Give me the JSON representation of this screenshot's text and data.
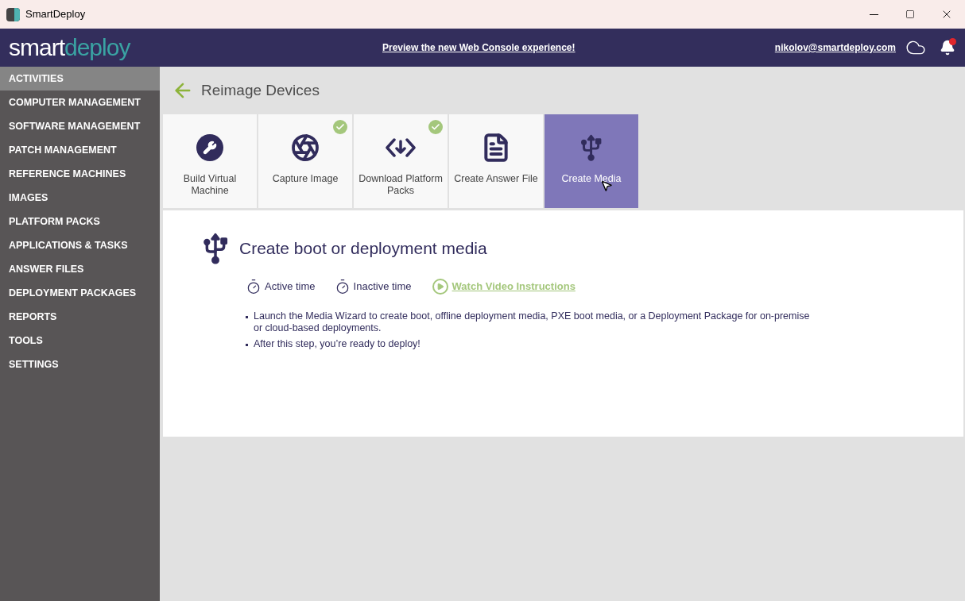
{
  "window": {
    "title": "SmartDeploy"
  },
  "header": {
    "logo": [
      "smart",
      "deploy"
    ],
    "banner_link": "Preview the new Web Console experience!",
    "user_email": "nikolov@smartdeploy.com",
    "notification_unread": true
  },
  "sidebar": {
    "items": [
      {
        "label": "ACTIVITIES",
        "selected": true
      },
      {
        "label": "COMPUTER MANAGEMENT",
        "selected": false
      },
      {
        "label": "SOFTWARE MANAGEMENT",
        "selected": false
      },
      {
        "label": "PATCH MANAGEMENT",
        "selected": false
      },
      {
        "label": "REFERENCE MACHINES",
        "selected": false
      },
      {
        "label": "IMAGES",
        "selected": false
      },
      {
        "label": "PLATFORM PACKS",
        "selected": false
      },
      {
        "label": "APPLICATIONS & TASKS",
        "selected": false
      },
      {
        "label": "ANSWER FILES",
        "selected": false
      },
      {
        "label": "DEPLOYMENT PACKAGES",
        "selected": false
      },
      {
        "label": "REPORTS",
        "selected": false
      },
      {
        "label": "TOOLS",
        "selected": false
      },
      {
        "label": "SETTINGS",
        "selected": false
      }
    ]
  },
  "page": {
    "title": "Reimage Devices"
  },
  "steps": [
    {
      "kind": "wrench",
      "label": "Build Virtual Machine",
      "done": false,
      "selected": false
    },
    {
      "kind": "aperture",
      "label": "Capture Image",
      "done": true,
      "selected": false
    },
    {
      "kind": "download",
      "label": "Download Platform Packs",
      "done": true,
      "selected": false
    },
    {
      "kind": "file",
      "label": "Create Answer File",
      "done": false,
      "selected": false
    },
    {
      "kind": "usb",
      "label": "Create Media",
      "done": false,
      "selected": true
    }
  ],
  "detail": {
    "title": "Create boot or deployment media",
    "active_time": "Active time",
    "inactive_time": "Inactive time",
    "video_link": "Watch Video Instructions",
    "bullets": [
      "Launch the Media Wizard to create boot, offline deployment media, PXE boot media, or a Deployment Package for on-premise or cloud-based deployments.",
      "After this step, you’re ready to deploy!"
    ]
  }
}
